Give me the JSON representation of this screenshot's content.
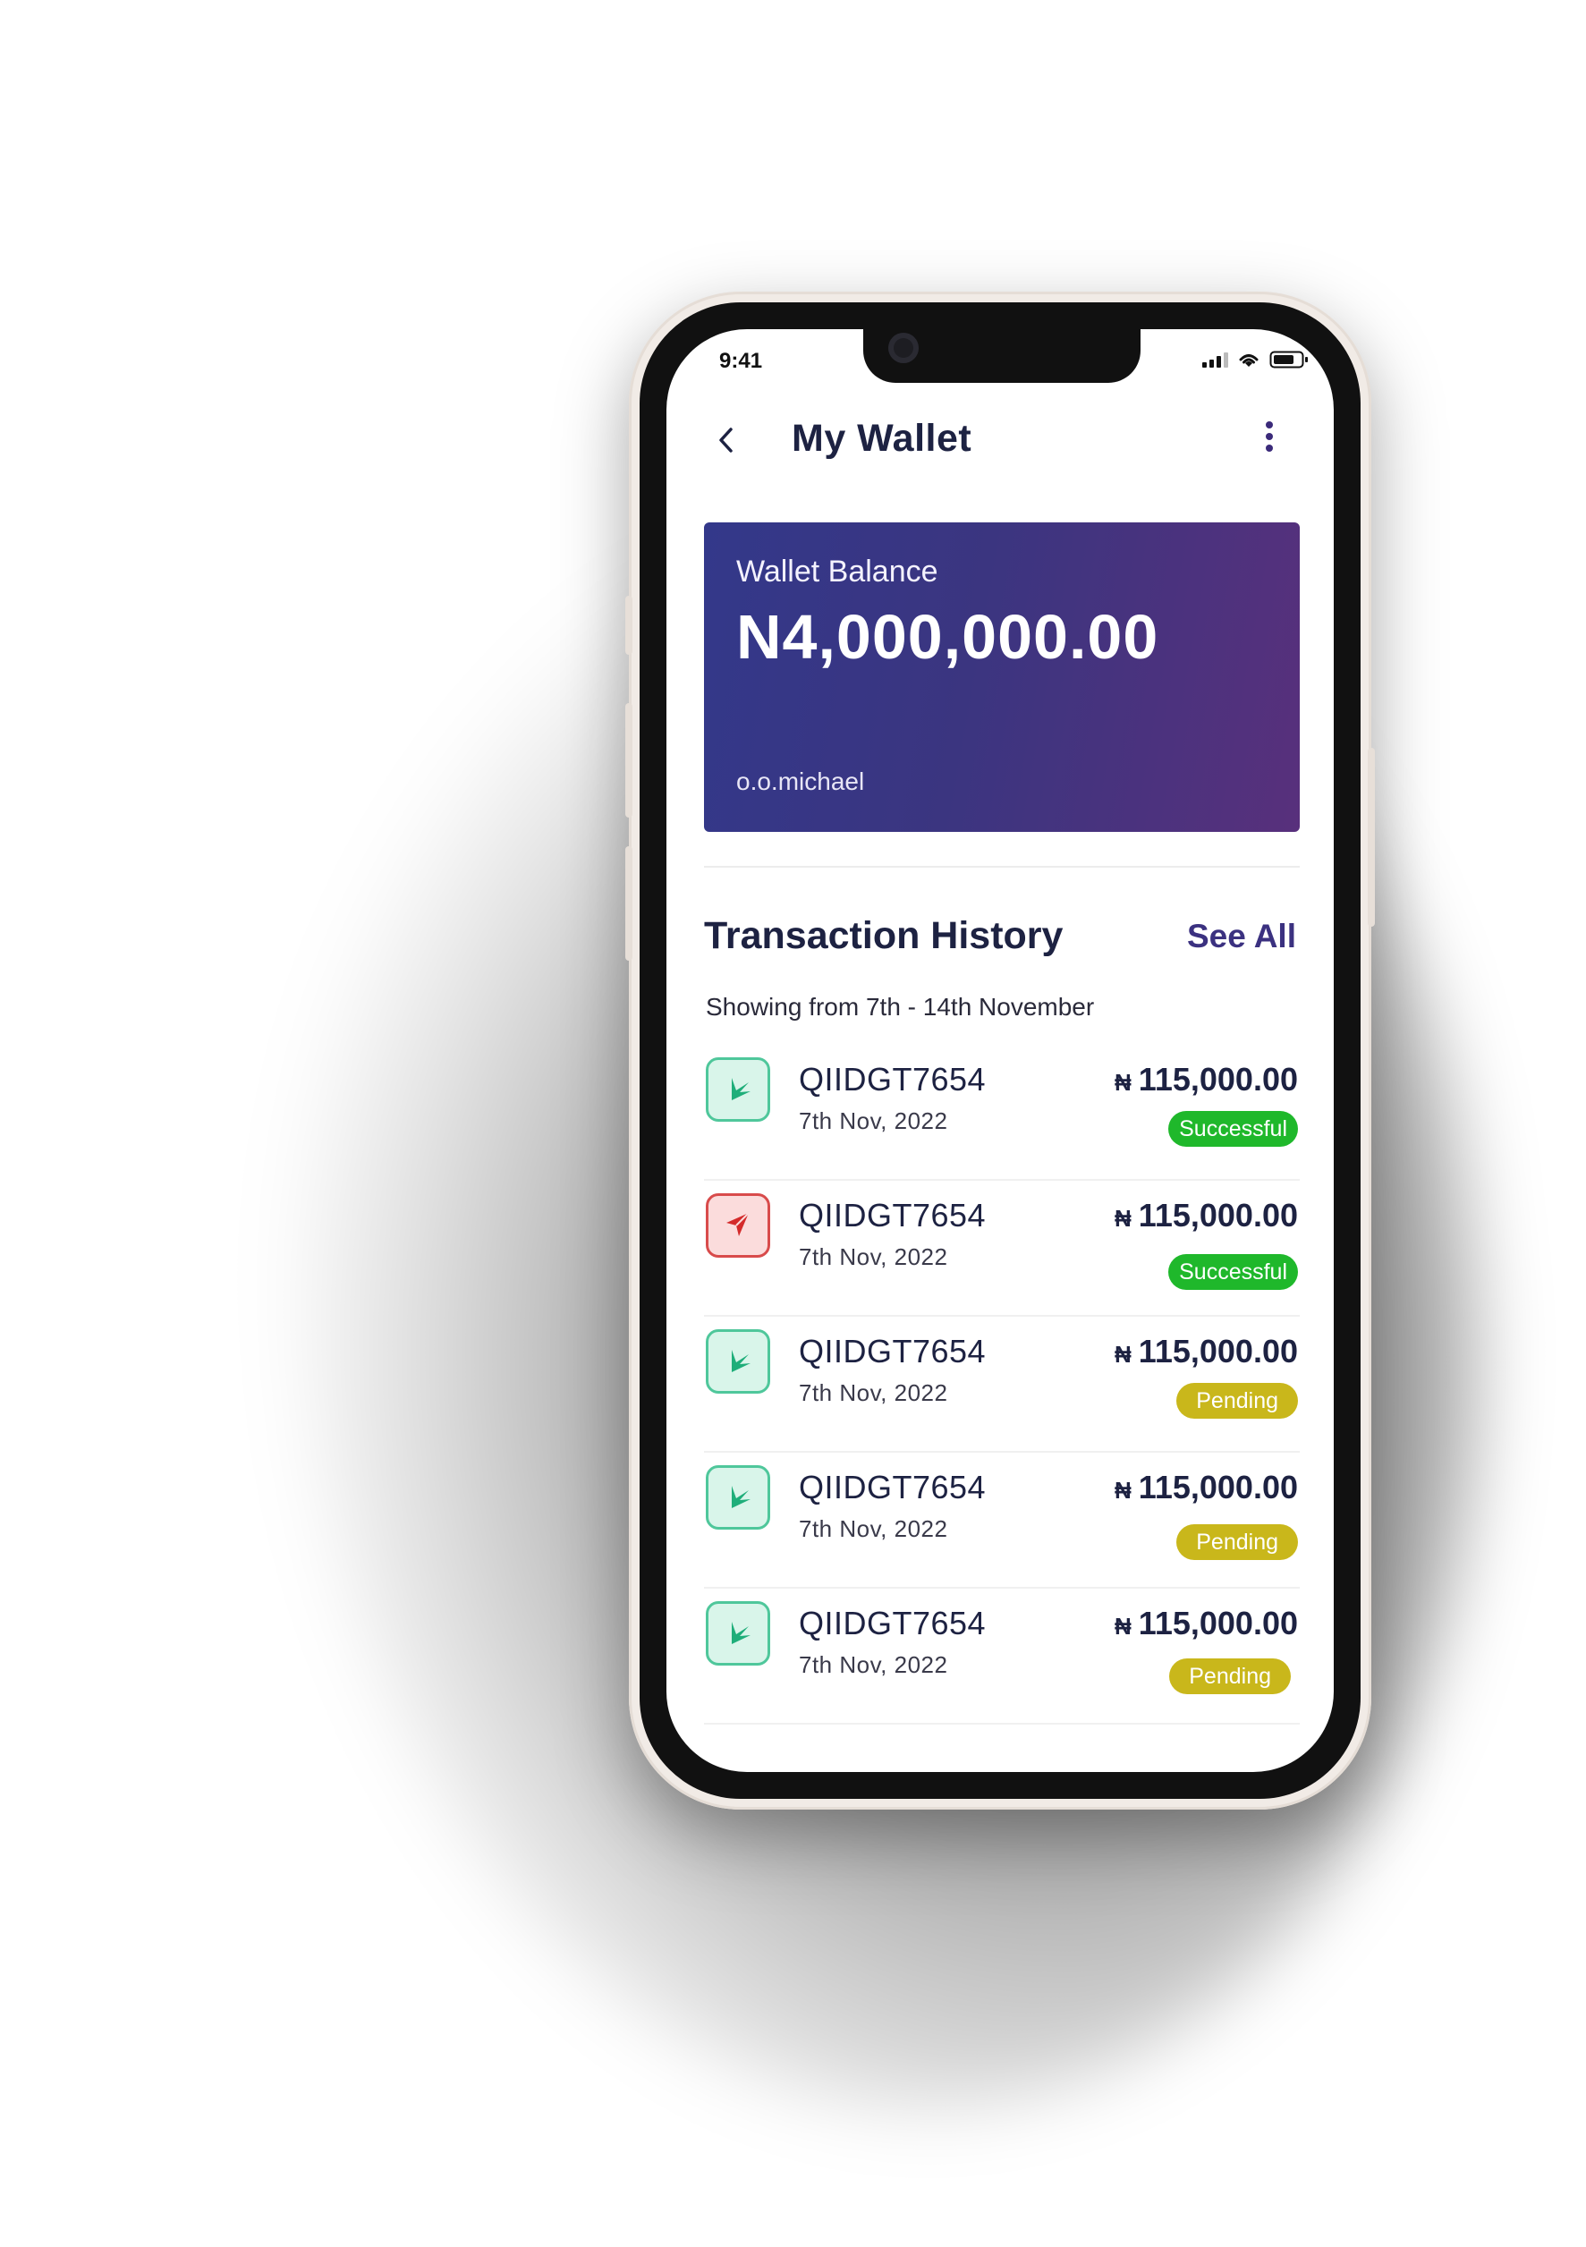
{
  "status_bar": {
    "time": "9:41"
  },
  "header": {
    "title": "My Wallet"
  },
  "wallet": {
    "label": "Wallet Balance",
    "balance": "N4,000,000.00",
    "username": "o.o.michael"
  },
  "transactions": {
    "title": "Transaction History",
    "see_all": "See All",
    "range": "Showing from 7th - 14th November",
    "currency_symbol": "₦",
    "items": [
      {
        "id": "QIIDGT7654",
        "date": "7th Nov, 2022",
        "amount": "115,000.00",
        "status": "Successful",
        "direction": "in"
      },
      {
        "id": "QIIDGT7654",
        "date": "7th Nov, 2022",
        "amount": "115,000.00",
        "status": "Successful",
        "direction": "out"
      },
      {
        "id": "QIIDGT7654",
        "date": "7th Nov, 2022",
        "amount": "115,000.00",
        "status": "Pending",
        "direction": "in"
      },
      {
        "id": "QIIDGT7654",
        "date": "7th Nov, 2022",
        "amount": "115,000.00",
        "status": "Pending",
        "direction": "in"
      },
      {
        "id": "QIIDGT7654",
        "date": "7th Nov, 2022",
        "amount": "115,000.00",
        "status": "Pending",
        "direction": "in"
      }
    ]
  },
  "colors": {
    "card_start": "#33388a",
    "card_end": "#58307c",
    "success": "#1fb82b",
    "pending": "#c9b71b",
    "incoming": "#1fae7a",
    "outgoing": "#d42b2b"
  }
}
